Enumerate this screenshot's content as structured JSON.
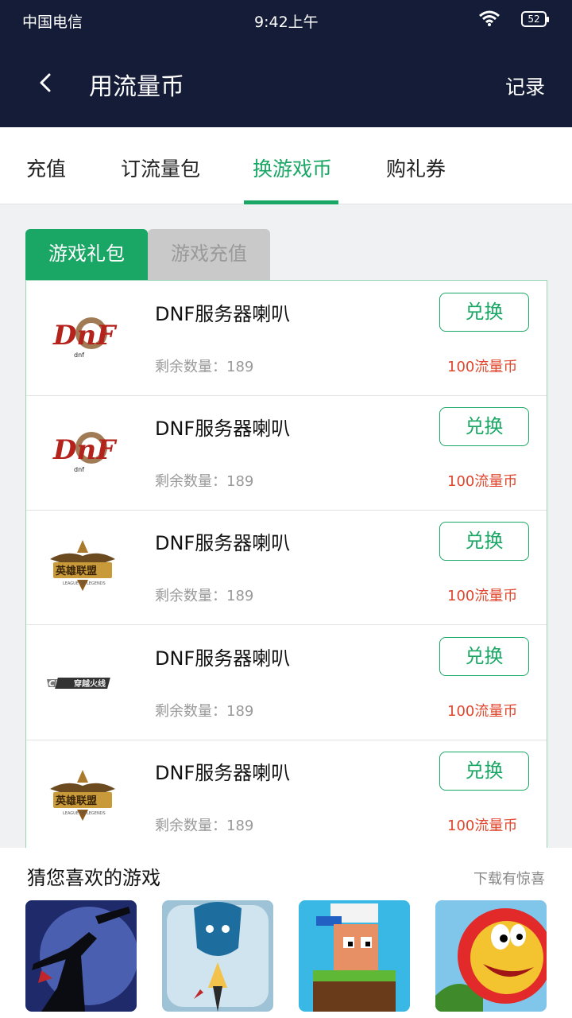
{
  "status_bar": {
    "carrier": "中国电信",
    "time": "9:42上午",
    "battery": "52"
  },
  "header": {
    "title": "用流量币",
    "record": "记录"
  },
  "tabs": [
    {
      "label": "充值"
    },
    {
      "label": "订流量包"
    },
    {
      "label": "换游戏币",
      "active": true
    },
    {
      "label": "购礼券"
    }
  ],
  "sub_tabs": [
    {
      "label": "游戏礼包",
      "active": true
    },
    {
      "label": "游戏充值"
    }
  ],
  "items": [
    {
      "name": "DNF服务器喇叭",
      "remain": "剩余数量：189",
      "button": "兑换",
      "price": "100流量币",
      "logo": "dnf-logo"
    },
    {
      "name": "DNF服务器喇叭",
      "remain": "剩余数量：189",
      "button": "兑换",
      "price": "100流量币",
      "logo": "dnf-logo"
    },
    {
      "name": "DNF服务器喇叭",
      "remain": "剩余数量：189",
      "button": "兑换",
      "price": "100流量币",
      "logo": "lol-logo"
    },
    {
      "name": "DNF服务器喇叭",
      "remain": "剩余数量：189",
      "button": "兑换",
      "price": "100流量币",
      "logo": "cf-logo"
    },
    {
      "name": "DNF服务器喇叭",
      "remain": "剩余数量：189",
      "button": "兑换",
      "price": "100流量币",
      "logo": "lol-logo"
    }
  ],
  "recommend": {
    "title": "猜您喜欢的游戏",
    "more": "下载有惊喜",
    "games": [
      "ninja-game-icon",
      "hero-game-icon",
      "pixel-game-icon",
      "bird-game-icon"
    ]
  },
  "colors": {
    "header_bg": "#141c38",
    "accent": "#1aa765",
    "price": "#e0462c"
  }
}
